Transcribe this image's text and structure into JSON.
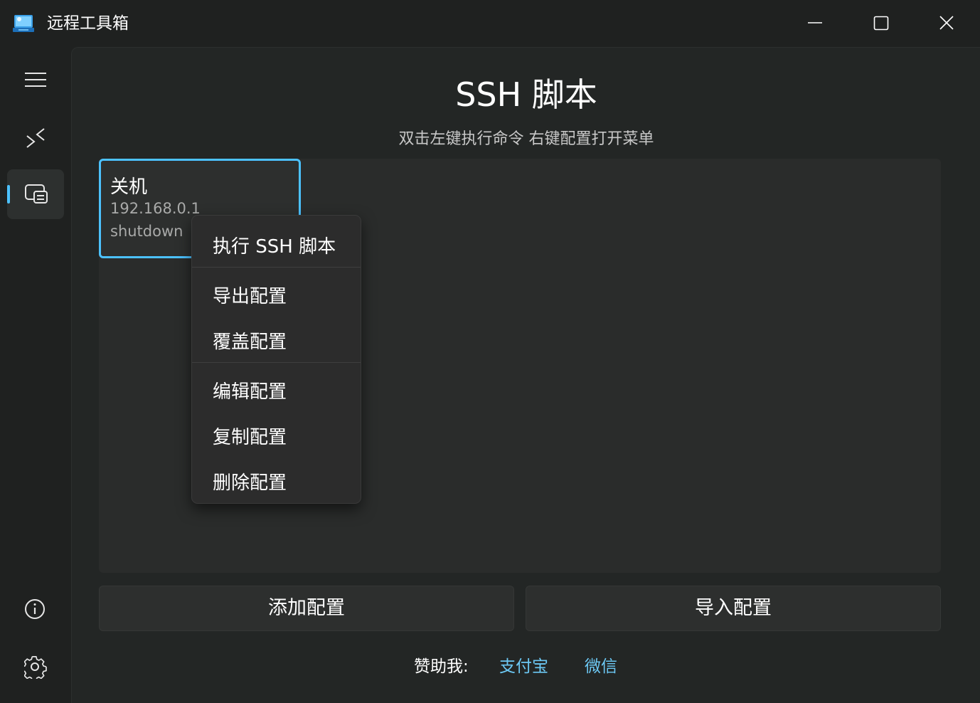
{
  "window": {
    "title": "远程工具箱",
    "controls": [
      "minimize",
      "maximize",
      "close"
    ]
  },
  "nav": {
    "items": [
      {
        "name": "menu",
        "icon": "hamburger-icon"
      },
      {
        "name": "remote-desktop",
        "icon": "remote-connect-icon"
      },
      {
        "name": "ssh-script",
        "icon": "ssh-script-icon",
        "selected": true
      },
      {
        "name": "about",
        "icon": "info-icon"
      },
      {
        "name": "settings",
        "icon": "gear-icon"
      }
    ]
  },
  "page": {
    "title": "SSH 脚本",
    "subtitle": "双击左键执行命令 右键配置打开菜单"
  },
  "configs": [
    {
      "name": "关机",
      "host": "192.168.0.1",
      "command": "shutdown",
      "selected": true
    }
  ],
  "context_menu": {
    "items": [
      "执行 SSH 脚本",
      "导出配置",
      "覆盖配置",
      "编辑配置",
      "复制配置",
      "删除配置"
    ]
  },
  "actions": {
    "add": "添加配置",
    "import": "导入配置"
  },
  "sponsor": {
    "label": "赞助我:",
    "alipay": "支付宝",
    "wechat": "微信"
  },
  "colors": {
    "accent": "#4cc2ff",
    "link": "#6cc8f4",
    "background": "#1f2120"
  }
}
